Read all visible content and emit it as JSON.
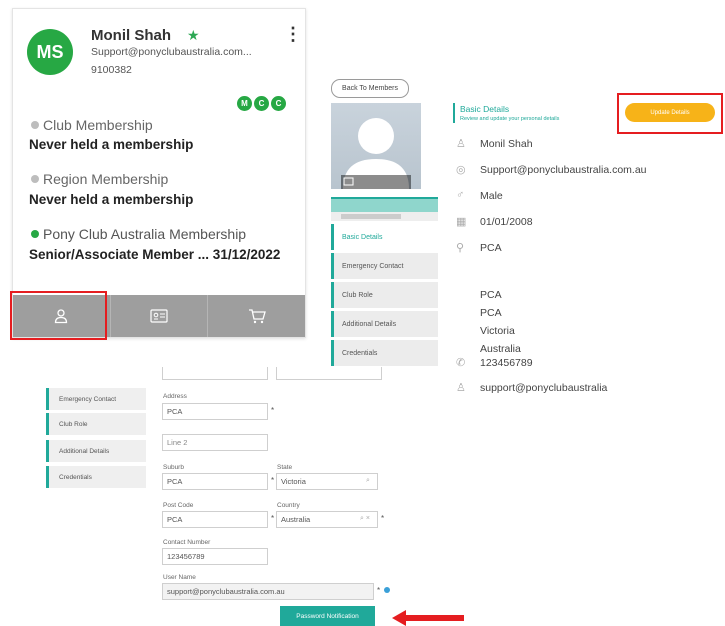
{
  "member": {
    "initials": "MS",
    "name": "Monil Shah",
    "email": "Support@ponyclubaustralia.com...",
    "phone": "9100382",
    "badges": [
      "M",
      "C",
      "C"
    ],
    "memberships": [
      {
        "title": "Club Membership",
        "value": "Never held a membership",
        "dot_color": "#bdbdbd"
      },
      {
        "title": "Region Membership",
        "value": "Never held a membership",
        "dot_color": "#bdbdbd"
      },
      {
        "title": "Pony Club Australia Membership",
        "value": "Senior/Associate Member ... 31/12/2022",
        "dot_color": "#27a844"
      }
    ],
    "nav_icons": [
      "person-icon",
      "id-card-icon",
      "cart-icon"
    ]
  },
  "profile": {
    "back_label": "Back To Members",
    "photo_strip": "Profile Photo",
    "nav": [
      "Basic Details",
      "Emergency Contact",
      "Club Role",
      "Additional Details",
      "Credentials"
    ],
    "section_title": "Basic Details",
    "section_subtitle": "Review and update your personal details",
    "update_label": "Update Details",
    "fields": {
      "name": "Monil Shah",
      "email": "Support@ponyclubaustralia.com.au",
      "gender": "Male",
      "dob": "01/01/2008",
      "club": "PCA",
      "address1": "PCA",
      "address2": "PCA",
      "state": "Victoria",
      "country": "Australia",
      "phone": "123456789",
      "username": "support@ponyclubaustralia"
    }
  },
  "form": {
    "nav": [
      "Emergency Contact",
      "Club Role",
      "Additional Details",
      "Credentials"
    ],
    "address_label": "Address",
    "address_value": "PCA",
    "line2_placeholder": "Line 2",
    "suburb_label": "Suburb",
    "suburb_value": "PCA",
    "state_label": "State",
    "state_value": "Victoria",
    "postcode_label": "Post Code",
    "postcode_value": "PCA",
    "country_label": "Country",
    "country_value": "Australia",
    "contact_label": "Contact Number",
    "contact_value": "123456789",
    "username_label": "User Name",
    "username_value": "support@ponyclubaustralia.com.au",
    "password_button": "Password Notification",
    "required_mark": "*"
  },
  "colors": {
    "accent": "#20a99a",
    "brand_green": "#27a844",
    "highlight": "#e51d20",
    "update": "#f7b318"
  }
}
